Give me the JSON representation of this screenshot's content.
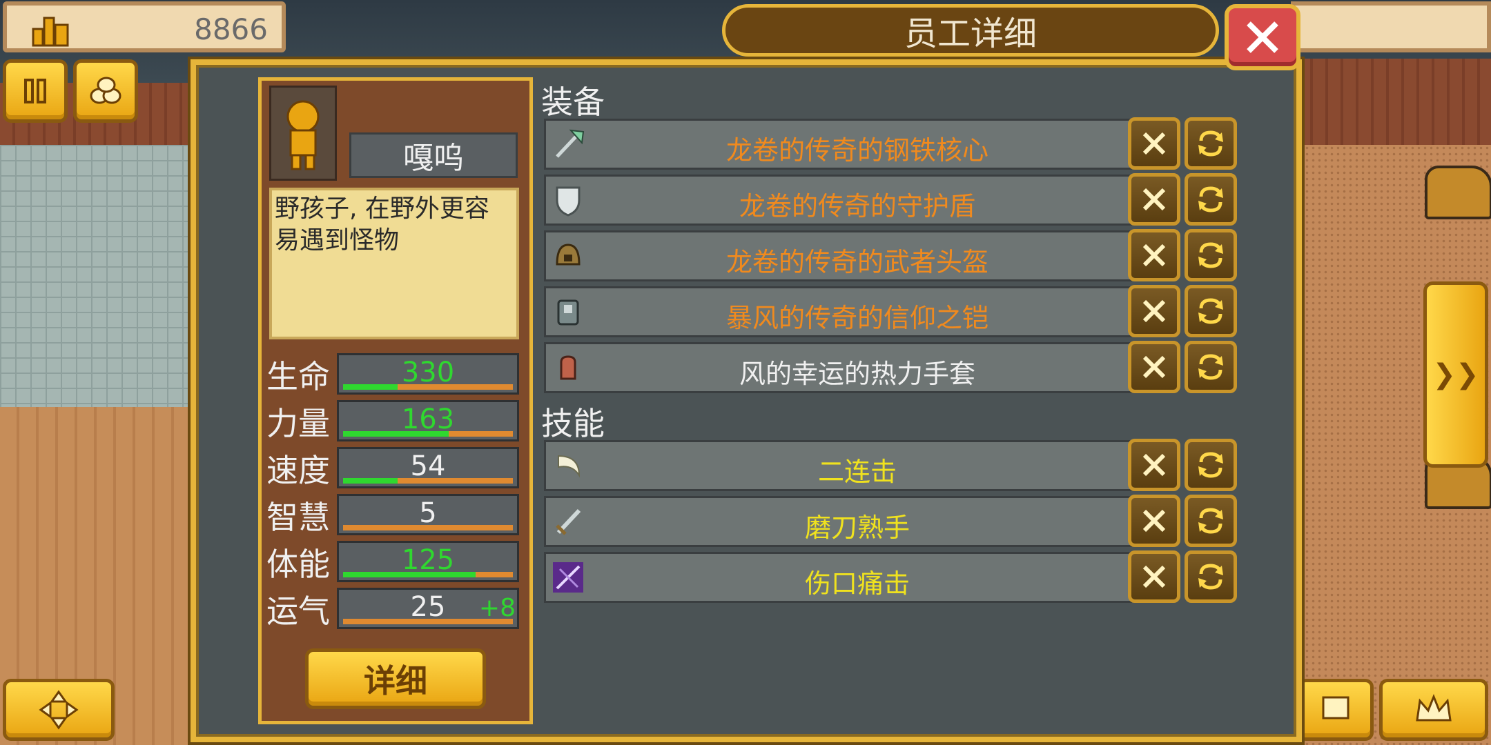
{
  "hud": {
    "money": "8866",
    "money_icon": "gold-bars-icon"
  },
  "dialog": {
    "title": "员工详细",
    "close_icon": "close-icon"
  },
  "employee": {
    "name": "嘎呜",
    "description": "野孩子, 在野外更容易遇到怪物",
    "stats": [
      {
        "label": "生命",
        "value": "330",
        "value_color": "#2fd82f",
        "fill": 0.32,
        "bonus": ""
      },
      {
        "label": "力量",
        "value": "163",
        "value_color": "#2fd82f",
        "fill": 0.62,
        "bonus": ""
      },
      {
        "label": "速度",
        "value": "54",
        "value_color": "#f0f0f0",
        "fill": 0.32,
        "bonus": ""
      },
      {
        "label": "智慧",
        "value": "5",
        "value_color": "#f0f0f0",
        "fill": 0.0,
        "bonus": ""
      },
      {
        "label": "体能",
        "value": "125",
        "value_color": "#2fd82f",
        "fill": 0.78,
        "bonus": ""
      },
      {
        "label": "运气",
        "value": "25",
        "value_color": "#f0f0f0",
        "fill": 0.0,
        "bonus": "+8"
      }
    ],
    "detail_button": "详细"
  },
  "equipment": {
    "label": "装备",
    "items": [
      {
        "name": "龙卷的传奇的钢铁核心",
        "color": "#f08a1e",
        "icon": "axe-icon"
      },
      {
        "name": "龙卷的传奇的守护盾",
        "color": "#f08a1e",
        "icon": "shield-icon"
      },
      {
        "name": "龙卷的传奇的武者头盔",
        "color": "#f08a1e",
        "icon": "helmet-icon"
      },
      {
        "name": "暴风的传奇的信仰之铠",
        "color": "#f08a1e",
        "icon": "armor-icon"
      },
      {
        "name": "风的幸运的热力手套",
        "color": "#f0f0f0",
        "icon": "glove-icon"
      }
    ]
  },
  "skills": {
    "label": "技能",
    "items": [
      {
        "name": "二连击",
        "color": "#f0e21e",
        "icon": "double-strike-icon"
      },
      {
        "name": "磨刀熟手",
        "color": "#f0e21e",
        "icon": "sword-icon"
      },
      {
        "name": "伤口痛击",
        "color": "#f0e21e",
        "icon": "wound-strike-icon"
      }
    ]
  }
}
